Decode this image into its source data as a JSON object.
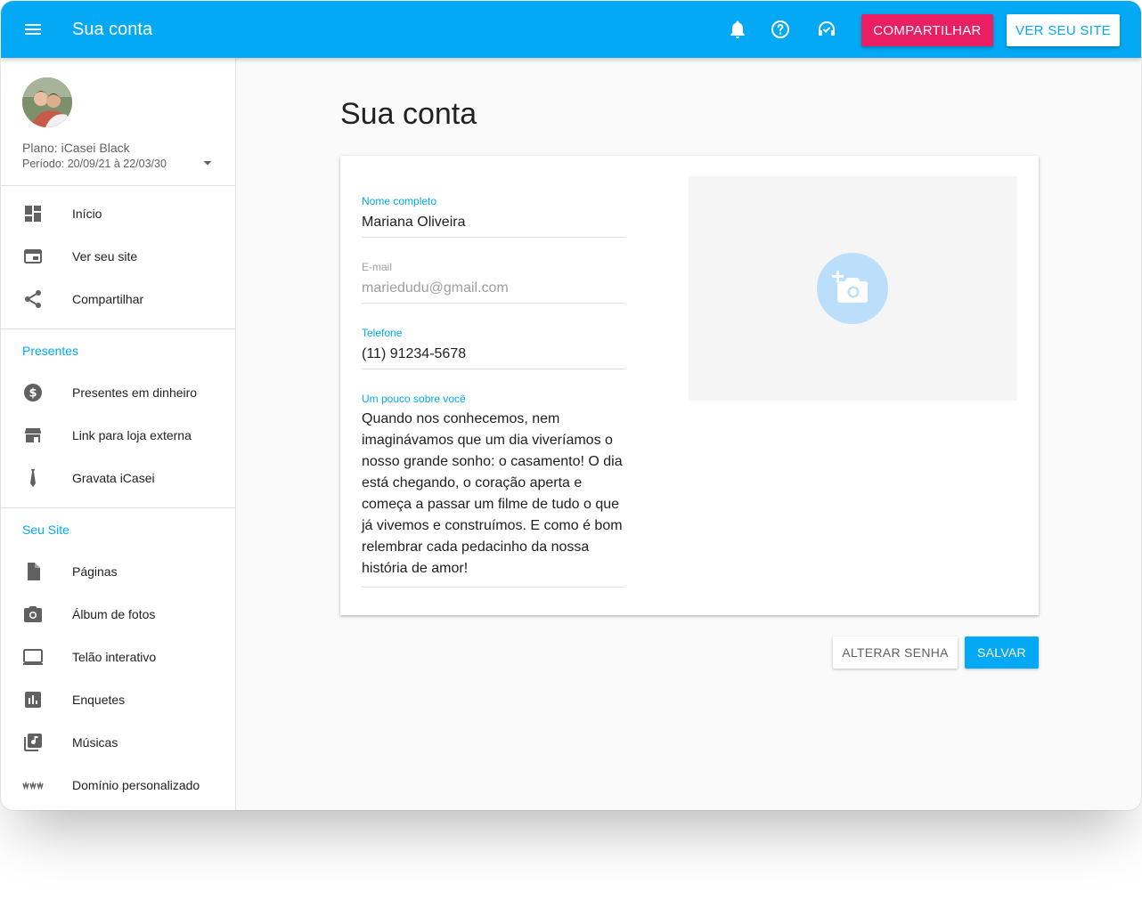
{
  "header": {
    "title": "Sua conta",
    "share_label": "COMPARTILHAR",
    "view_site_label": "VER SEU SITE",
    "icons": [
      "menu-icon",
      "bell-icon",
      "help-icon",
      "support-icon"
    ]
  },
  "sidebar": {
    "plan": "Plano: iCasei Black",
    "period": "Período: 20/09/21 à 22/03/30",
    "main_items": [
      {
        "label": "Início",
        "icon": "dashboard-icon"
      },
      {
        "label": "Ver seu site",
        "icon": "browser-icon"
      },
      {
        "label": "Compartilhar",
        "icon": "share-icon"
      }
    ],
    "gifts_section": "Presentes",
    "gift_items": [
      {
        "label": "Presentes em dinheiro",
        "icon": "dollar-icon"
      },
      {
        "label": "Link para loja externa",
        "icon": "store-icon"
      },
      {
        "label": "Gravata iCasei",
        "icon": "tie-icon"
      }
    ],
    "site_section": "Seu Site",
    "site_items": [
      {
        "label": "Páginas",
        "icon": "page-icon"
      },
      {
        "label": "Álbum de fotos",
        "icon": "camera-icon"
      },
      {
        "label": "Telão interativo",
        "icon": "screen-icon"
      },
      {
        "label": "Enquetes",
        "icon": "poll-icon"
      },
      {
        "label": "Músicas",
        "icon": "music-icon"
      },
      {
        "label": "Domínio personalizado",
        "icon": "www-icon"
      }
    ]
  },
  "main": {
    "title": "Sua conta",
    "fields": {
      "name_label": "Nome completo",
      "name_value": "Mariana Oliveira",
      "email_label": "E-mail",
      "email_value": "mariedudu@gmail.com",
      "phone_label": "Telefone",
      "phone_value": "(11) 91234-5678",
      "about_label": "Um pouco sobre você",
      "about_value": "Quando nos conhecemos, nem imaginávamos que um dia viveríamos o nosso grande sonho: o casamento! O dia está chegando, o coração aperta e começa a passar um filme de tudo o que já vivemos e construímos. E como é bom relembrar cada pedacinho da nossa história de amor!"
    },
    "change_password_label": "ALTERAR SENHA",
    "save_label": "SALVAR"
  },
  "colors": {
    "primary": "#03a9f4",
    "accent": "#e91e63"
  }
}
